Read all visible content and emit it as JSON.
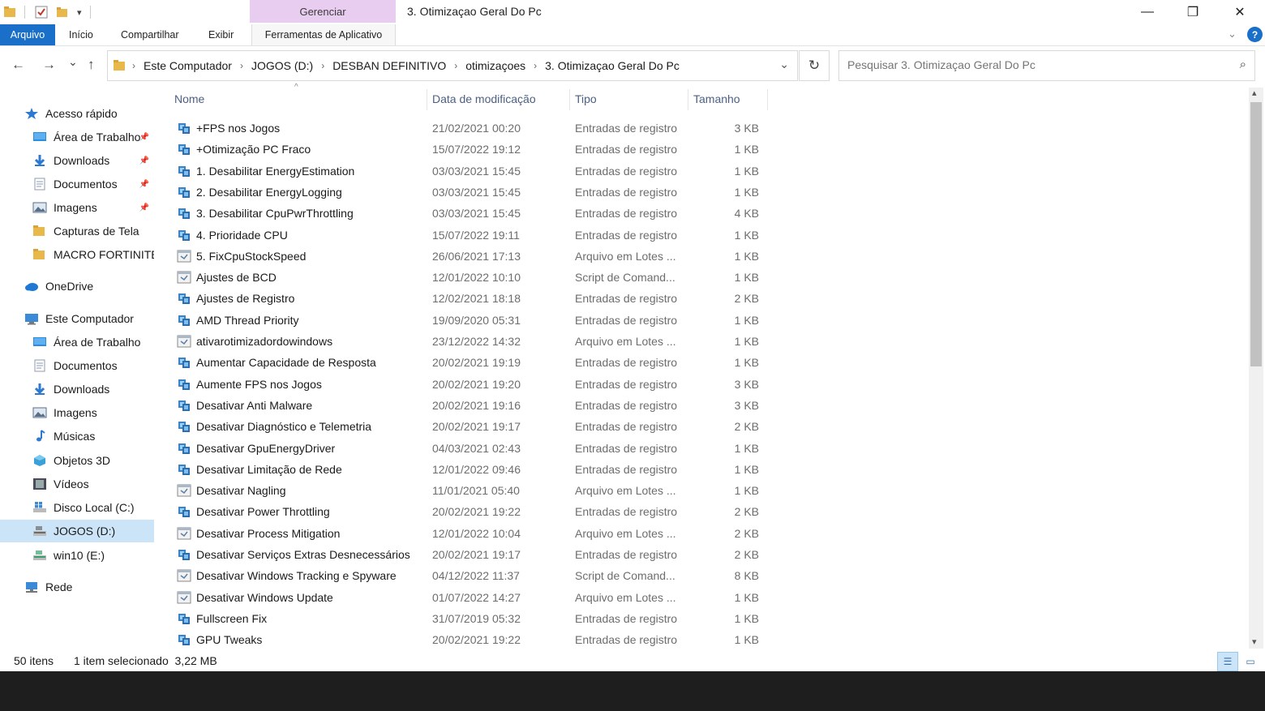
{
  "window": {
    "title": "3. Otimizaçao Geral Do Pc",
    "manage_tab": "Gerenciar",
    "controls": {
      "minimize": "—",
      "maximize": "❐",
      "close": "✕"
    }
  },
  "ribbon": {
    "tabs": [
      "Arquivo",
      "Início",
      "Compartilhar",
      "Exibir",
      "Ferramentas de Aplicativo"
    ],
    "help": "?"
  },
  "navigation": {
    "back": "←",
    "forward": "→",
    "recent": "⌄",
    "up": "↑",
    "refresh": "↻",
    "breadcrumb": [
      "Este Computador",
      "JOGOS (D:)",
      "DESBAN DEFINITIVO",
      "otimizaçoes",
      "3. Otimizaçao Geral Do Pc"
    ],
    "search_placeholder": "Pesquisar 3. Otimizaçao Geral Do Pc"
  },
  "sidebar": {
    "items": [
      {
        "label": "Acesso rápido",
        "icon": "star-icon",
        "color": "#2b79d0",
        "level": 0
      },
      {
        "label": "Área de Trabalho",
        "icon": "desktop-icon",
        "color": "#2b8ce0",
        "level": 1,
        "pinned": true
      },
      {
        "label": "Downloads",
        "icon": "download-icon",
        "color": "#2b79d0",
        "level": 1,
        "pinned": true
      },
      {
        "label": "Documentos",
        "icon": "document-icon",
        "color": "#8f9bb0",
        "level": 1,
        "pinned": true
      },
      {
        "label": "Imagens",
        "icon": "image-icon",
        "color": "#5a6f8a",
        "level": 1,
        "pinned": true
      },
      {
        "label": "Capturas de Tela",
        "icon": "folder-icon",
        "color": "#e8b84a",
        "level": 1
      },
      {
        "label": "MACRO FORTINITE",
        "icon": "folder-icon",
        "color": "#e8b84a",
        "level": 1
      },
      {
        "label": "OneDrive",
        "icon": "cloud-icon",
        "color": "#1e78d4",
        "level": 0
      },
      {
        "label": "Este Computador",
        "icon": "computer-icon",
        "color": "#3a8ad8",
        "level": 0
      },
      {
        "label": "Área de Trabalho",
        "icon": "desktop-icon",
        "color": "#2b8ce0",
        "level": 1
      },
      {
        "label": "Documentos",
        "icon": "document-icon",
        "color": "#8f9bb0",
        "level": 1
      },
      {
        "label": "Downloads",
        "icon": "download-icon",
        "color": "#2b79d0",
        "level": 1
      },
      {
        "label": "Imagens",
        "icon": "image-icon",
        "color": "#5a6f8a",
        "level": 1
      },
      {
        "label": "Músicas",
        "icon": "music-icon",
        "color": "#2b79d0",
        "level": 1
      },
      {
        "label": "Objetos 3D",
        "icon": "cube-icon",
        "color": "#3aa0d8",
        "level": 1
      },
      {
        "label": "Vídeos",
        "icon": "video-icon",
        "color": "#4a4a5a",
        "level": 1
      },
      {
        "label": "Disco Local (C:)",
        "icon": "windows-drive-icon",
        "color": "#3a8ad8",
        "level": 1
      },
      {
        "label": "JOGOS (D:)",
        "icon": "drive-icon",
        "color": "#6b6b6b",
        "level": 1,
        "selected": true
      },
      {
        "label": "win10 (E:)",
        "icon": "drive-icon",
        "color": "#3aa070",
        "level": 1
      },
      {
        "label": "Rede",
        "icon": "network-icon",
        "color": "#3a8ad8",
        "level": 0
      }
    ]
  },
  "file_list": {
    "columns": {
      "name": "Nome",
      "date": "Data de modificação",
      "type": "Tipo",
      "size": "Tamanho"
    },
    "rows": [
      {
        "name": "+FPS nos Jogos",
        "date": "21/02/2021 00:20",
        "type": "Entradas de registro",
        "size": "3 KB",
        "icon": "registry-icon"
      },
      {
        "name": "+Otimização PC Fraco",
        "date": "15/07/2022 19:12",
        "type": "Entradas de registro",
        "size": "1 KB",
        "icon": "registry-icon"
      },
      {
        "name": "1. Desabilitar EnergyEstimation",
        "date": "03/03/2021 15:45",
        "type": "Entradas de registro",
        "size": "1 KB",
        "icon": "registry-icon"
      },
      {
        "name": "2. Desabilitar EnergyLogging",
        "date": "03/03/2021 15:45",
        "type": "Entradas de registro",
        "size": "1 KB",
        "icon": "registry-icon"
      },
      {
        "name": "3. Desabilitar CpuPwrThrottling",
        "date": "03/03/2021 15:45",
        "type": "Entradas de registro",
        "size": "4 KB",
        "icon": "registry-icon"
      },
      {
        "name": "4. Prioridade CPU",
        "date": "15/07/2022 19:11",
        "type": "Entradas de registro",
        "size": "1 KB",
        "icon": "registry-icon"
      },
      {
        "name": "5. FixCpuStockSpeed",
        "date": "26/06/2021 17:13",
        "type": "Arquivo em Lotes ...",
        "size": "1 KB",
        "icon": "batch-icon"
      },
      {
        "name": "Ajustes de BCD",
        "date": "12/01/2022 10:10",
        "type": "Script de Comand...",
        "size": "1 KB",
        "icon": "batch-icon"
      },
      {
        "name": "Ajustes de Registro",
        "date": "12/02/2021 18:18",
        "type": "Entradas de registro",
        "size": "2 KB",
        "icon": "registry-icon"
      },
      {
        "name": "AMD Thread Priority",
        "date": "19/09/2020 05:31",
        "type": "Entradas de registro",
        "size": "1 KB",
        "icon": "registry-icon"
      },
      {
        "name": "ativarotimizadordowindows",
        "date": "23/12/2022 14:32",
        "type": "Arquivo em Lotes ...",
        "size": "1 KB",
        "icon": "batch-icon"
      },
      {
        "name": "Aumentar Capacidade de Resposta",
        "date": "20/02/2021 19:19",
        "type": "Entradas de registro",
        "size": "1 KB",
        "icon": "registry-icon"
      },
      {
        "name": "Aumente FPS nos Jogos",
        "date": "20/02/2021 19:20",
        "type": "Entradas de registro",
        "size": "3 KB",
        "icon": "registry-icon"
      },
      {
        "name": "Desativar Anti Malware",
        "date": "20/02/2021 19:16",
        "type": "Entradas de registro",
        "size": "3 KB",
        "icon": "registry-icon"
      },
      {
        "name": "Desativar Diagnóstico e Telemetria",
        "date": "20/02/2021 19:17",
        "type": "Entradas de registro",
        "size": "2 KB",
        "icon": "registry-icon"
      },
      {
        "name": "Desativar GpuEnergyDriver",
        "date": "04/03/2021 02:43",
        "type": "Entradas de registro",
        "size": "1 KB",
        "icon": "registry-icon"
      },
      {
        "name": "Desativar Limitação de Rede",
        "date": "12/01/2022 09:46",
        "type": "Entradas de registro",
        "size": "1 KB",
        "icon": "registry-icon"
      },
      {
        "name": "Desativar Nagling",
        "date": "11/01/2021 05:40",
        "type": "Arquivo em Lotes ...",
        "size": "1 KB",
        "icon": "batch-icon"
      },
      {
        "name": "Desativar Power Throttling",
        "date": "20/02/2021 19:22",
        "type": "Entradas de registro",
        "size": "2 KB",
        "icon": "registry-icon"
      },
      {
        "name": "Desativar Process Mitigation",
        "date": "12/01/2022 10:04",
        "type": "Arquivo em Lotes ...",
        "size": "2 KB",
        "icon": "batch-icon"
      },
      {
        "name": "Desativar Serviços Extras Desnecessários",
        "date": "20/02/2021 19:17",
        "type": "Entradas de registro",
        "size": "2 KB",
        "icon": "registry-icon"
      },
      {
        "name": "Desativar Windows Tracking e Spyware",
        "date": "04/12/2022 11:37",
        "type": "Script de Comand...",
        "size": "8 KB",
        "icon": "batch-icon"
      },
      {
        "name": "Desativar Windows Update",
        "date": "01/07/2022 14:27",
        "type": "Arquivo em Lotes ...",
        "size": "1 KB",
        "icon": "batch-icon"
      },
      {
        "name": "Fullscreen Fix",
        "date": "31/07/2019 05:32",
        "type": "Entradas de registro",
        "size": "1 KB",
        "icon": "registry-icon"
      },
      {
        "name": "GPU Tweaks",
        "date": "20/02/2021 19:22",
        "type": "Entradas de registro",
        "size": "1 KB",
        "icon": "registry-icon"
      }
    ]
  },
  "status": {
    "count": "50 itens",
    "selection": "1 item selecionado  3,22 MB"
  },
  "colors": {
    "accent": "#1a6fc9",
    "manage_tab": "#e9cdf0",
    "selected": "#cce4f7",
    "header_text": "#4d6082"
  }
}
